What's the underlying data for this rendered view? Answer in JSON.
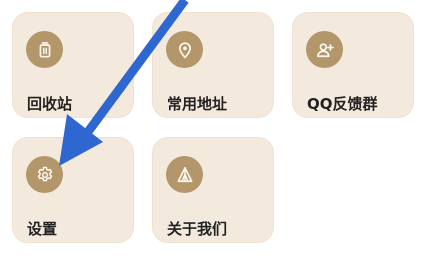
{
  "colors": {
    "card_background": "#f3eadd",
    "card_border": "#efe2cf",
    "icon_circle": "#b3976a",
    "icon_glyph": "#fdf8ef",
    "label_text": "#222222",
    "arrow": "#2f67d1"
  },
  "cards": [
    {
      "label": "回收站",
      "icon": "trash-icon"
    },
    {
      "label": "常用地址",
      "icon": "location-pin-icon"
    },
    {
      "label": "QQ反馈群",
      "icon": "add-user-icon"
    },
    {
      "label": "设置",
      "icon": "gear-icon"
    },
    {
      "label": "关于我们",
      "icon": "tent-icon"
    }
  ],
  "overlay": {
    "icon": "pointer-arrow-icon"
  }
}
